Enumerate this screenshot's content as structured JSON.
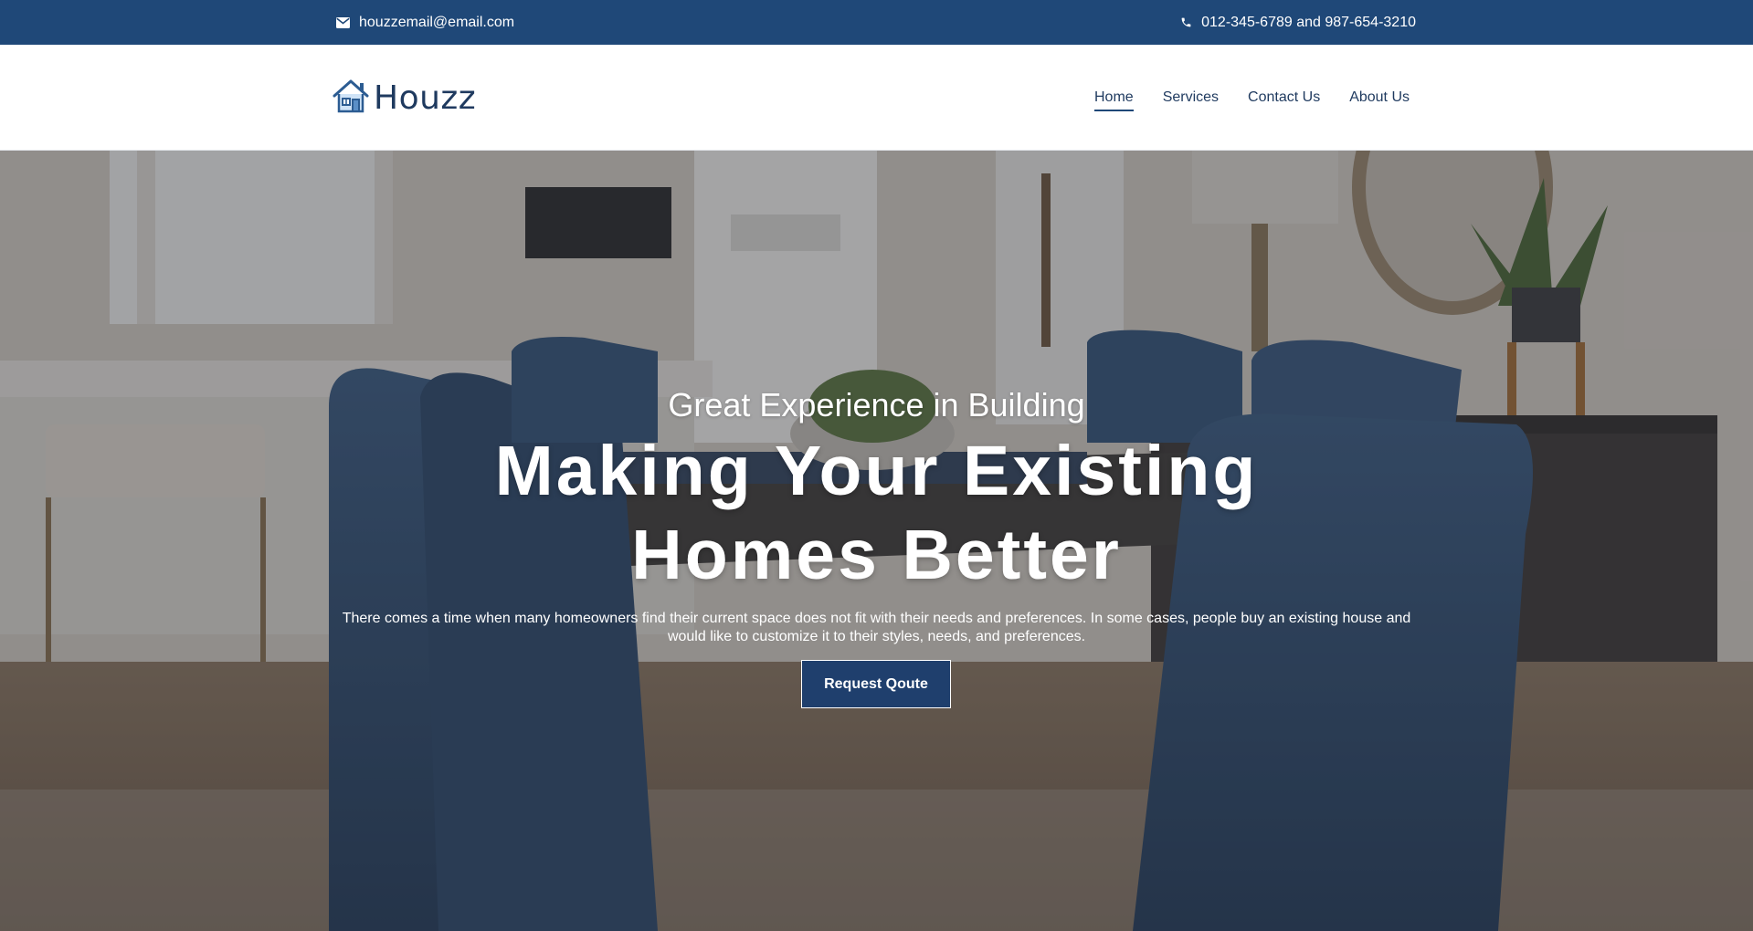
{
  "topbar": {
    "email": "houzzemail@email.com",
    "phone": "012-345-6789 and 987-654-3210",
    "email_icon": "envelope-icon",
    "phone_icon": "phone-icon"
  },
  "header": {
    "logo_text": "Houzz",
    "logo_icon": "house-icon",
    "nav": [
      {
        "label": "Home",
        "active": true
      },
      {
        "label": "Services",
        "active": false
      },
      {
        "label": "Contact Us",
        "active": false
      },
      {
        "label": "About Us",
        "active": false
      }
    ]
  },
  "hero": {
    "eyebrow": "Great Experience in Building",
    "title_line1": "Making Your Existing",
    "title_line2": "Homes Better",
    "description": "There comes a time when many homeowners find their current space does not fit with their needs and preferences. In some cases, people buy an existing house and would like to customize it to their styles, needs, and preferences.",
    "button_label": "Request Qoute"
  },
  "colors": {
    "brand": "#1f4878",
    "button": "#1f3f6d",
    "nav_text": "#1f3a5f"
  }
}
